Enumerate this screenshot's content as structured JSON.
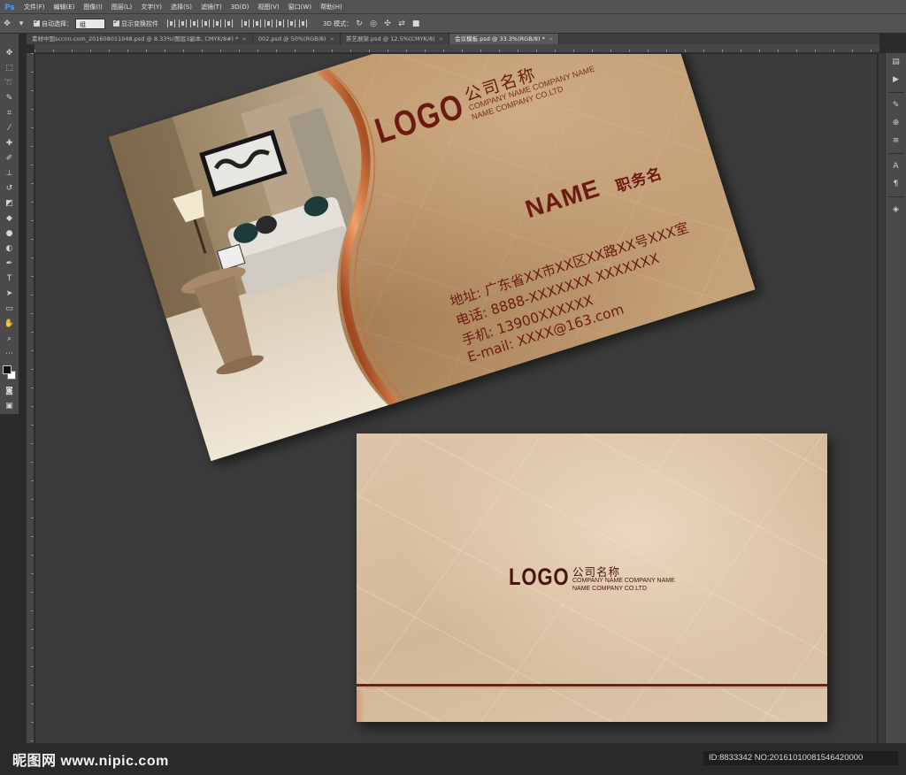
{
  "app": {
    "logo": "Ps"
  },
  "menu": [
    "文件(F)",
    "编辑(E)",
    "图像(I)",
    "图层(L)",
    "文字(Y)",
    "选择(S)",
    "滤镜(T)",
    "3D(D)",
    "视图(V)",
    "窗口(W)",
    "帮助(H)"
  ],
  "options": {
    "auto_select_label": "自动选择：",
    "auto_select_value": "组",
    "show_transform_label": "显示变换控件",
    "mode3d_label": "3D 模式："
  },
  "tabs": [
    {
      "label": "素材中国sccnn.com_201608011048.psd @ 8.33%(图层3副本, CMYK/8#) *"
    },
    {
      "label": "002.psd @ 50%(RGB/8)"
    },
    {
      "label": "茶艺展架.psd @ 12.5%(CMYK/8)"
    },
    {
      "label": "会议模板.psd @ 33.3%(RGB/8) *"
    }
  ],
  "front": {
    "logo": "LOGO",
    "company_name": "公司名称",
    "sub1": "COMPANY NAME COMPANY NAME",
    "sub2": "NAME COMPANY CO.LTD",
    "name": "NAME",
    "title": "职务名",
    "address": "地址: 广东省XX市XX区XX路XX号XXX室",
    "phone": "电话: 8888-XXXXXXX  XXXXXXX",
    "mobile": "手机: 13900XXXXXX",
    "email": "E-mail: XXXX@163.com"
  },
  "back": {
    "logo": "LOGO",
    "company_name": "公司名称",
    "sub1": "COMPANY NAME COMPANY NAME",
    "sub2": "NAME COMPANY CO.LTD"
  },
  "watermark": "昵图网 www.nipic.com",
  "id_text": "ID:8833342 NO:20161010081546420000",
  "colors": {
    "accent": "#6b1a12",
    "ps_blue": "#4fa8ff"
  }
}
